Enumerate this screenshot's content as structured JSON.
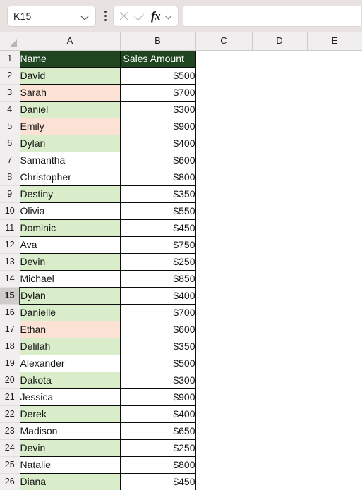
{
  "app": {
    "type": "spreadsheet"
  },
  "formula_bar": {
    "name_box_value": "K15",
    "name_box_placeholder": "Name Box",
    "formula_value": "",
    "formula_placeholder": "",
    "cancel_icon": "close-icon",
    "enter_icon": "check-icon",
    "function_icon": "fx-icon",
    "menu_icon": "kebab-menu-icon",
    "dropdown_icon": "chevron-down-icon"
  },
  "grid": {
    "select_all_icon": "select-all-triangle-icon",
    "column_headers": [
      "A",
      "B",
      "C",
      "D",
      "E"
    ],
    "row_headers": [
      "1",
      "2",
      "3",
      "4",
      "5",
      "6",
      "7",
      "8",
      "9",
      "10",
      "11",
      "12",
      "13",
      "14",
      "15",
      "16",
      "17",
      "18",
      "19",
      "20",
      "21",
      "22",
      "23",
      "24",
      "25",
      "26"
    ],
    "selected_row": "15",
    "selected_cell": "A15",
    "header_fill": "#1f4620",
    "header_text_color": "#ffffff",
    "fill_green": "#d9edcb",
    "fill_peach": "#fbe2d5",
    "headers": {
      "a": "Name",
      "b": "Sales Amount"
    },
    "rows": [
      {
        "row": "2",
        "name": "David",
        "amount": "$500",
        "fill": "green"
      },
      {
        "row": "3",
        "name": "Sarah",
        "amount": "$700",
        "fill": "peach"
      },
      {
        "row": "4",
        "name": "Daniel",
        "amount": "$300",
        "fill": "green"
      },
      {
        "row": "5",
        "name": "Emily",
        "amount": "$900",
        "fill": "peach"
      },
      {
        "row": "6",
        "name": "Dylan",
        "amount": "$400",
        "fill": "green"
      },
      {
        "row": "7",
        "name": "Samantha",
        "amount": "$600",
        "fill": "none"
      },
      {
        "row": "8",
        "name": "Christopher",
        "amount": "$800",
        "fill": "none"
      },
      {
        "row": "9",
        "name": "Destiny",
        "amount": "$350",
        "fill": "green"
      },
      {
        "row": "10",
        "name": "Olivia",
        "amount": "$550",
        "fill": "none"
      },
      {
        "row": "11",
        "name": "Dominic",
        "amount": "$450",
        "fill": "green"
      },
      {
        "row": "12",
        "name": "Ava",
        "amount": "$750",
        "fill": "none"
      },
      {
        "row": "13",
        "name": "Devin",
        "amount": "$250",
        "fill": "green"
      },
      {
        "row": "14",
        "name": "Michael",
        "amount": "$850",
        "fill": "none"
      },
      {
        "row": "15",
        "name": "Dylan",
        "amount": "$400",
        "fill": "green",
        "selected": true
      },
      {
        "row": "16",
        "name": "Danielle",
        "amount": "$700",
        "fill": "green"
      },
      {
        "row": "17",
        "name": "Ethan",
        "amount": "$600",
        "fill": "peach"
      },
      {
        "row": "18",
        "name": "Delilah",
        "amount": "$350",
        "fill": "green"
      },
      {
        "row": "19",
        "name": "Alexander",
        "amount": "$500",
        "fill": "none"
      },
      {
        "row": "20",
        "name": "Dakota",
        "amount": "$300",
        "fill": "green"
      },
      {
        "row": "21",
        "name": "Jessica",
        "amount": "$900",
        "fill": "none"
      },
      {
        "row": "22",
        "name": "Derek",
        "amount": "$400",
        "fill": "green"
      },
      {
        "row": "23",
        "name": "Madison",
        "amount": "$650",
        "fill": "none"
      },
      {
        "row": "24",
        "name": "Devin",
        "amount": "$250",
        "fill": "green"
      },
      {
        "row": "25",
        "name": "Natalie",
        "amount": "$800",
        "fill": "none"
      },
      {
        "row": "26",
        "name": "Diana",
        "amount": "$450",
        "fill": "green"
      }
    ]
  }
}
